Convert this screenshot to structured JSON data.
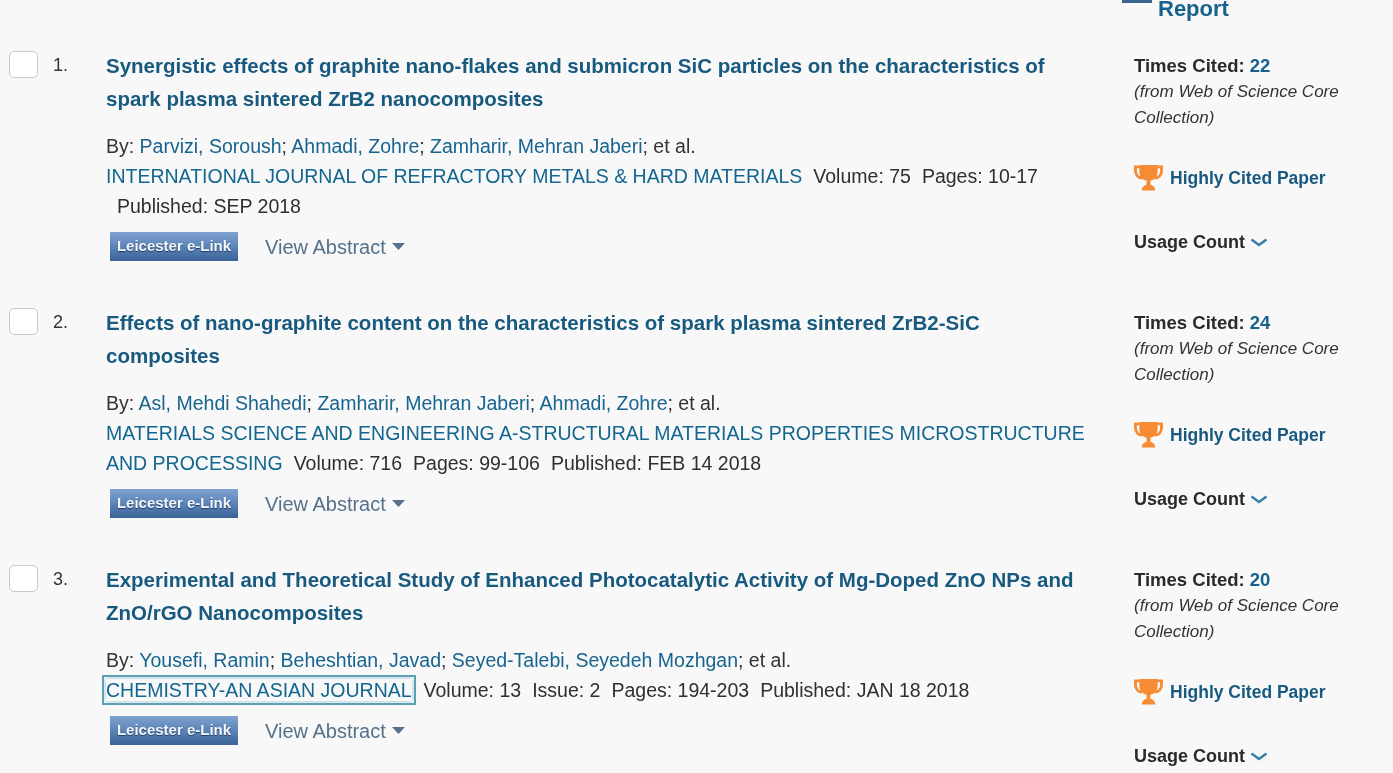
{
  "header": {
    "report_link": "Report"
  },
  "records": [
    {
      "number": "1.",
      "checked": false,
      "title": "Synergistic effects of graphite nano-flakes and submicron SiC particles on the characteristics of spark plasma sintered ZrB2 nanocomposites",
      "byline": [
        {
          "kind": "plain",
          "text": "By: "
        },
        {
          "kind": "author",
          "text": "Parvizi, Soroush"
        },
        {
          "kind": "plain",
          "text": "; "
        },
        {
          "kind": "author",
          "text": "Ahmadi, Zohre"
        },
        {
          "kind": "plain",
          "text": "; "
        },
        {
          "kind": "author",
          "text": "Zamharir, Mehran Jaberi"
        },
        {
          "kind": "plain",
          "text": "; et al."
        }
      ],
      "journal": {
        "name": "INTERNATIONAL JOURNAL OF REFRACTORY METALS & HARD MATERIALS",
        "focused": false
      },
      "details": [
        "Volume: 75",
        "Pages: 10-17",
        "Published: SEP 2018"
      ],
      "link_button": "Leicester e-Link",
      "abstract_toggle": "View Abstract",
      "times_cited": {
        "label": "Times Cited:",
        "count": "22",
        "source": "(from Web of Science Core Collection)"
      },
      "badge": "Highly Cited Paper",
      "usage_count": "Usage Count"
    },
    {
      "number": "2.",
      "checked": false,
      "title": "Effects of nano-graphite content on the characteristics of spark plasma sintered ZrB2-SiC composites",
      "byline": [
        {
          "kind": "plain",
          "text": "By: "
        },
        {
          "kind": "author",
          "text": "Asl, Mehdi Shahedi"
        },
        {
          "kind": "plain",
          "text": "; "
        },
        {
          "kind": "author",
          "text": "Zamharir, Mehran Jaberi"
        },
        {
          "kind": "plain",
          "text": "; "
        },
        {
          "kind": "author",
          "text": "Ahmadi, Zohre"
        },
        {
          "kind": "plain",
          "text": "; et al."
        }
      ],
      "journal": {
        "name": "MATERIALS SCIENCE AND ENGINEERING A-STRUCTURAL MATERIALS PROPERTIES MICROSTRUCTURE AND PROCESSING",
        "focused": false
      },
      "details": [
        "Volume: 716",
        "Pages: 99-106",
        "Published: FEB 14 2018"
      ],
      "link_button": "Leicester e-Link",
      "abstract_toggle": "View Abstract",
      "times_cited": {
        "label": "Times Cited:",
        "count": "24",
        "source": "(from Web of Science Core Collection)"
      },
      "badge": "Highly Cited Paper",
      "usage_count": "Usage Count"
    },
    {
      "number": "3.",
      "checked": false,
      "title": "Experimental and Theoretical Study of Enhanced Photocatalytic Activity of Mg-Doped ZnO NPs and ZnO/rGO Nanocomposites",
      "byline": [
        {
          "kind": "plain",
          "text": "By: "
        },
        {
          "kind": "author",
          "text": "Yousefi, Ramin"
        },
        {
          "kind": "plain",
          "text": "; "
        },
        {
          "kind": "author",
          "text": "Beheshtian, Javad"
        },
        {
          "kind": "plain",
          "text": "; "
        },
        {
          "kind": "author",
          "text": "Seyed-Talebi, Seyedeh Mozhgan"
        },
        {
          "kind": "plain",
          "text": "; et al."
        }
      ],
      "journal": {
        "name": "CHEMISTRY-AN ASIAN JOURNAL",
        "focused": true
      },
      "details": [
        "Volume: 13",
        "Issue: 2",
        "Pages: 194-203",
        "Published: JAN 18 2018"
      ],
      "link_button": "Leicester e-Link",
      "abstract_toggle": "View Abstract",
      "times_cited": {
        "label": "Times Cited:",
        "count": "20",
        "source": "(from Web of Science Core Collection)"
      },
      "badge": "Highly Cited Paper",
      "usage_count": "Usage Count"
    }
  ]
}
